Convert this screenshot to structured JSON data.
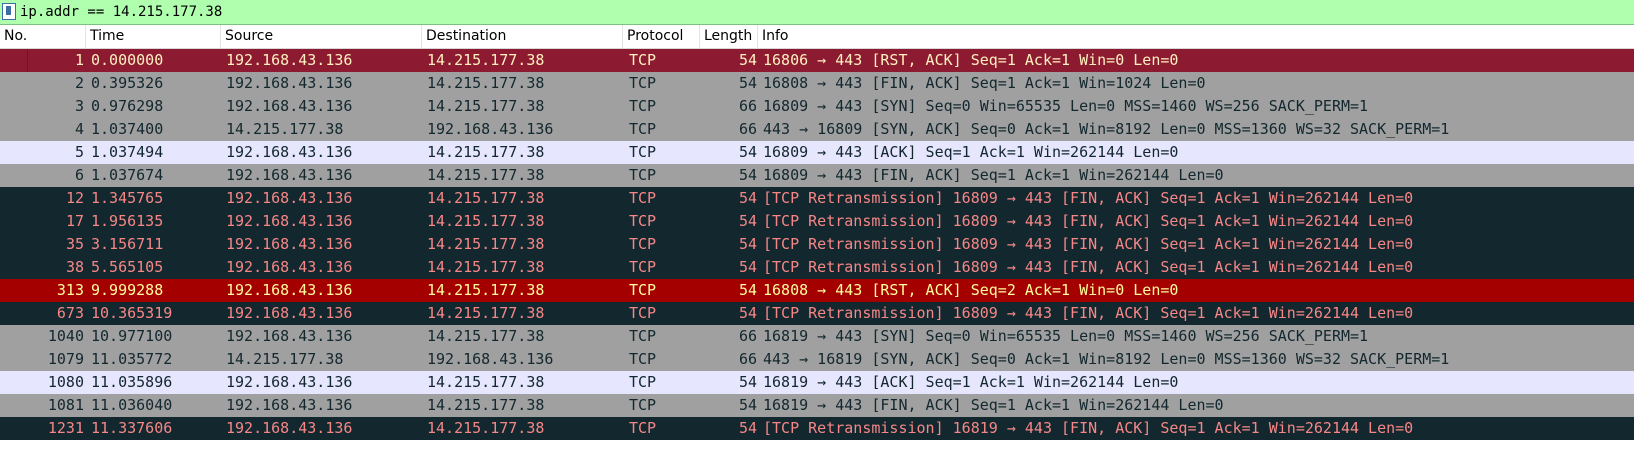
{
  "filter": {
    "value": "ip.addr == 14.215.177.38"
  },
  "columns": [
    "No.",
    "Time",
    "Source",
    "Destination",
    "Protocol",
    "Length",
    "Info"
  ],
  "colors": {
    "rst_selected_bg": "#8c1a30",
    "rst_selected_fg": "#fff0c0",
    "fin_bg": "#a0a0a0",
    "fin_fg": "#12272e",
    "ack_bg": "#e7e6ff",
    "ack_fg": "#12272e",
    "retrans_bg": "#12272e",
    "retrans_fg": "#f78787",
    "rst_bg": "#a40000",
    "rst_fg": "#fffc9c",
    "filter_bg": "#afffaf"
  },
  "packets": [
    {
      "no": "1",
      "time": "0.000000",
      "src": "192.168.43.136",
      "dst": "14.215.177.38",
      "proto": "TCP",
      "len": "54",
      "info": "16806 → 443 [RST, ACK] Seq=1 Ack=1 Win=0 Len=0",
      "style": "rst_selected"
    },
    {
      "no": "2",
      "time": "0.395326",
      "src": "192.168.43.136",
      "dst": "14.215.177.38",
      "proto": "TCP",
      "len": "54",
      "info": "16808 → 443 [FIN, ACK] Seq=1 Ack=1 Win=1024 Len=0",
      "style": "fin"
    },
    {
      "no": "3",
      "time": "0.976298",
      "src": "192.168.43.136",
      "dst": "14.215.177.38",
      "proto": "TCP",
      "len": "66",
      "info": "16809 → 443 [SYN] Seq=0 Win=65535 Len=0 MSS=1460 WS=256 SACK_PERM=1",
      "style": "fin"
    },
    {
      "no": "4",
      "time": "1.037400",
      "src": "14.215.177.38",
      "dst": "192.168.43.136",
      "proto": "TCP",
      "len": "66",
      "info": "443 → 16809 [SYN, ACK] Seq=0 Ack=1 Win=8192 Len=0 MSS=1360 WS=32 SACK_PERM=1",
      "style": "fin"
    },
    {
      "no": "5",
      "time": "1.037494",
      "src": "192.168.43.136",
      "dst": "14.215.177.38",
      "proto": "TCP",
      "len": "54",
      "info": "16809 → 443 [ACK] Seq=1 Ack=1 Win=262144 Len=0",
      "style": "ack"
    },
    {
      "no": "6",
      "time": "1.037674",
      "src": "192.168.43.136",
      "dst": "14.215.177.38",
      "proto": "TCP",
      "len": "54",
      "info": "16809 → 443 [FIN, ACK] Seq=1 Ack=1 Win=262144 Len=0",
      "style": "fin"
    },
    {
      "no": "12",
      "time": "1.345765",
      "src": "192.168.43.136",
      "dst": "14.215.177.38",
      "proto": "TCP",
      "len": "54",
      "info": "[TCP Retransmission] 16809 → 443 [FIN, ACK] Seq=1 Ack=1 Win=262144 Len=0",
      "style": "retrans"
    },
    {
      "no": "17",
      "time": "1.956135",
      "src": "192.168.43.136",
      "dst": "14.215.177.38",
      "proto": "TCP",
      "len": "54",
      "info": "[TCP Retransmission] 16809 → 443 [FIN, ACK] Seq=1 Ack=1 Win=262144 Len=0",
      "style": "retrans"
    },
    {
      "no": "35",
      "time": "3.156711",
      "src": "192.168.43.136",
      "dst": "14.215.177.38",
      "proto": "TCP",
      "len": "54",
      "info": "[TCP Retransmission] 16809 → 443 [FIN, ACK] Seq=1 Ack=1 Win=262144 Len=0",
      "style": "retrans"
    },
    {
      "no": "38",
      "time": "5.565105",
      "src": "192.168.43.136",
      "dst": "14.215.177.38",
      "proto": "TCP",
      "len": "54",
      "info": "[TCP Retransmission] 16809 → 443 [FIN, ACK] Seq=1 Ack=1 Win=262144 Len=0",
      "style": "retrans"
    },
    {
      "no": "313",
      "time": "9.999288",
      "src": "192.168.43.136",
      "dst": "14.215.177.38",
      "proto": "TCP",
      "len": "54",
      "info": "16808 → 443 [RST, ACK] Seq=2 Ack=1 Win=0 Len=0",
      "style": "rst"
    },
    {
      "no": "673",
      "time": "10.365319",
      "src": "192.168.43.136",
      "dst": "14.215.177.38",
      "proto": "TCP",
      "len": "54",
      "info": "[TCP Retransmission] 16809 → 443 [FIN, ACK] Seq=1 Ack=1 Win=262144 Len=0",
      "style": "retrans"
    },
    {
      "no": "1040",
      "time": "10.977100",
      "src": "192.168.43.136",
      "dst": "14.215.177.38",
      "proto": "TCP",
      "len": "66",
      "info": "16819 → 443 [SYN] Seq=0 Win=65535 Len=0 MSS=1460 WS=256 SACK_PERM=1",
      "style": "fin"
    },
    {
      "no": "1079",
      "time": "11.035772",
      "src": "14.215.177.38",
      "dst": "192.168.43.136",
      "proto": "TCP",
      "len": "66",
      "info": "443 → 16819 [SYN, ACK] Seq=0 Ack=1 Win=8192 Len=0 MSS=1360 WS=32 SACK_PERM=1",
      "style": "fin"
    },
    {
      "no": "1080",
      "time": "11.035896",
      "src": "192.168.43.136",
      "dst": "14.215.177.38",
      "proto": "TCP",
      "len": "54",
      "info": "16819 → 443 [ACK] Seq=1 Ack=1 Win=262144 Len=0",
      "style": "ack"
    },
    {
      "no": "1081",
      "time": "11.036040",
      "src": "192.168.43.136",
      "dst": "14.215.177.38",
      "proto": "TCP",
      "len": "54",
      "info": "16819 → 443 [FIN, ACK] Seq=1 Ack=1 Win=262144 Len=0",
      "style": "fin"
    },
    {
      "no": "1231",
      "time": "11.337606",
      "src": "192.168.43.136",
      "dst": "14.215.177.38",
      "proto": "TCP",
      "len": "54",
      "info": "[TCP Retransmission] 16819 → 443 [FIN, ACK] Seq=1 Ack=1 Win=262144 Len=0",
      "style": "retrans"
    }
  ]
}
